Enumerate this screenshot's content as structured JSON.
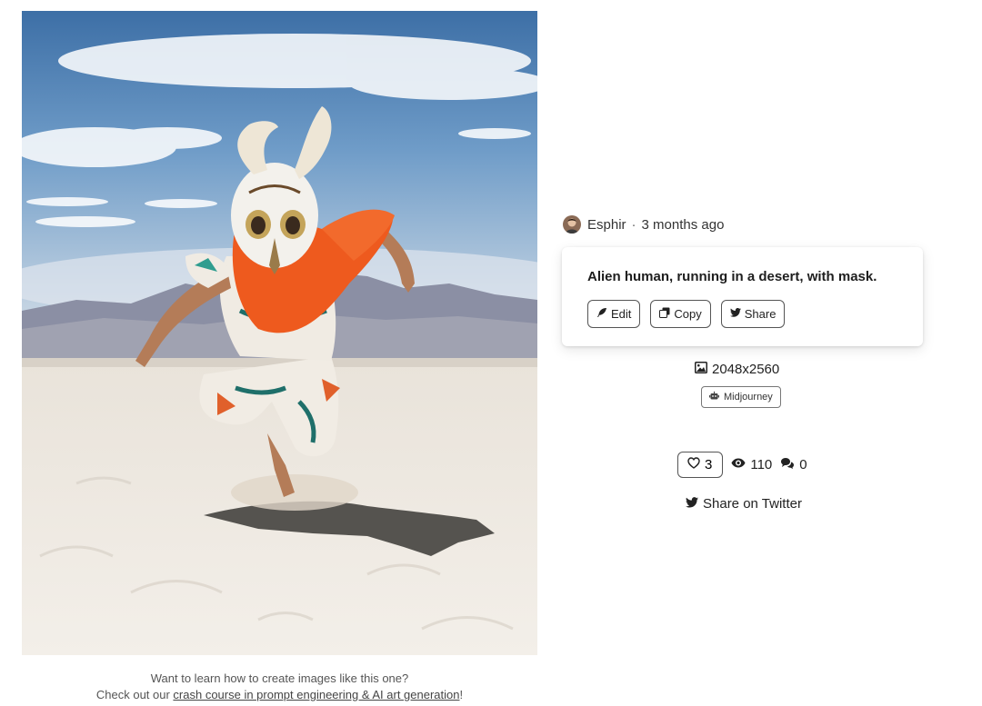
{
  "artwork": {
    "image_label": "Alien human, running in a desert, with mask."
  },
  "promo": {
    "line1": "Want to learn how to create images like this one?",
    "line2_prefix": "Check out our ",
    "link_text": "crash course in prompt engineering & AI art generation",
    "line2_suffix": "!"
  },
  "author": {
    "name": "Esphir",
    "separator": "·",
    "time_ago": "3 months ago"
  },
  "prompt": {
    "text": "Alien human, running in a desert, with mask.",
    "actions": {
      "edit_label": "Edit",
      "copy_label": "Copy",
      "share_label": "Share"
    }
  },
  "meta": {
    "dimensions": "2048x2560",
    "model": "Midjourney"
  },
  "stats": {
    "likes": "3",
    "views": "110",
    "comments": "0"
  },
  "share_twitter_label": "Share on Twitter",
  "icons": {
    "edit": "feather-icon",
    "copy": "copy-icon",
    "share": "twitter-icon",
    "dimensions": "image-icon",
    "model": "robot-icon",
    "likes": "heart-icon",
    "views": "eye-icon",
    "comments": "comments-icon"
  }
}
